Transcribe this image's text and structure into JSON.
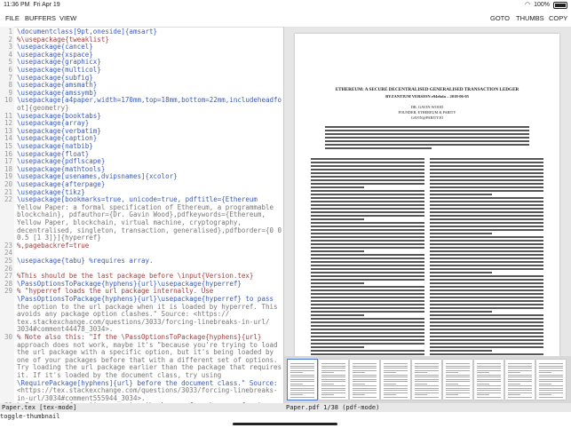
{
  "status": {
    "time": "11:36 PM",
    "date": "Fri Apr 19",
    "battery": "100%"
  },
  "menu": {
    "file": "FILE",
    "buffers": "BUFFERS",
    "view": "VIEW",
    "goto": "GOTO",
    "thumbs": "THUMBS",
    "copy": "COPY"
  },
  "editor": {
    "lines": [
      {
        "n": "1",
        "t": "\\documentclass[9pt,oneside]{amsart}"
      },
      {
        "n": "2",
        "t": "%\\usepackage{tweaklist}"
      },
      {
        "n": "3",
        "t": "\\usepackage{cancel}"
      },
      {
        "n": "4",
        "t": "\\usepackage{xspace}"
      },
      {
        "n": "5",
        "t": "\\usepackage{graphicx}"
      },
      {
        "n": "6",
        "t": "\\usepackage{multicol}"
      },
      {
        "n": "7",
        "t": "\\usepackage{subfig}"
      },
      {
        "n": "8",
        "t": "\\usepackage{amsmath}"
      },
      {
        "n": "9",
        "t": "\\usepackage{amssymb}"
      },
      {
        "n": "10",
        "t": "\\usepackage[a4paper,width=170mm,top=18mm,bottom=22mm,includeheadfo"
      },
      {
        "n": "",
        "t": "ot]{geometry}"
      },
      {
        "n": "11",
        "t": "\\usepackage{booktabs}"
      },
      {
        "n": "12",
        "t": "\\usepackage{array}"
      },
      {
        "n": "13",
        "t": "\\usepackage{verbatim}"
      },
      {
        "n": "14",
        "t": "\\usepackage{caption}"
      },
      {
        "n": "15",
        "t": "\\usepackage{natbib}"
      },
      {
        "n": "16",
        "t": "\\usepackage{float}"
      },
      {
        "n": "17",
        "t": "\\usepackage{pdflscape}"
      },
      {
        "n": "18",
        "t": "\\usepackage{mathtools}"
      },
      {
        "n": "19",
        "t": "\\usepackage[usenames,dvipsnames]{xcolor}"
      },
      {
        "n": "20",
        "t": "\\usepackage{afterpage}"
      },
      {
        "n": "21",
        "t": "\\usepackage{tikz}"
      },
      {
        "n": "22",
        "t": "\\usepackage[bookmarks=true, unicode=true, pdftitle={Ethereum"
      },
      {
        "n": "",
        "t": "Yellow Paper: a formal specification of Ethereum, a programmable"
      },
      {
        "n": "",
        "t": "blockchain}, pdfauthor={Dr. Gavin Wood},pdfkeywords={Ethereum,"
      },
      {
        "n": "",
        "t": "Yellow Paper, blockchain, virtual machine, cryptography,"
      },
      {
        "n": "",
        "t": "decentralised, singleton, transaction, generalised},pdfborder={0 0"
      },
      {
        "n": "",
        "t": "0.5 [1 3]}]{hyperref}"
      },
      {
        "n": "23",
        "t": "%,pagebackref=true"
      },
      {
        "n": "24",
        "t": ""
      },
      {
        "n": "25",
        "t": "\\usepackage{tabu} %requires array."
      },
      {
        "n": "26",
        "t": ""
      },
      {
        "n": "27",
        "t": "%This should be the last package before \\input{Version.tex}"
      },
      {
        "n": "28",
        "t": "\\PassOptionsToPackage{hyphens}{url}\\usepackage{hyperref}"
      },
      {
        "n": "29",
        "t": "% \"hyperref loads the url package internally. Use"
      },
      {
        "n": "",
        "t": "\\PassOptionsToPackage{hyphens}{url}\\usepackage{hyperref} to pass"
      },
      {
        "n": "",
        "t": "the option to the url package when it is loaded by hyperref. This"
      },
      {
        "n": "",
        "t": "avoids any package option clashes.\" Source: <https://"
      },
      {
        "n": "",
        "t": "tex.stackexchange.com/questions/3033/forcing-linebreaks-in-url/"
      },
      {
        "n": "",
        "t": "3034#comment44478_3034>."
      },
      {
        "n": "30",
        "t": "% Note also this: \"If the \\PassOptionsToPackage{hyphens}{url}"
      },
      {
        "n": "",
        "t": "approach does not work, maybe it's \"because you're trying to load"
      },
      {
        "n": "",
        "t": "the url package with a specific option, but it's being loaded by"
      },
      {
        "n": "",
        "t": "one of your packages before that with a different set of options."
      },
      {
        "n": "",
        "t": "Try loading the url package earlier than the package that requires"
      },
      {
        "n": "",
        "t": "it. If it's loaded by the document class, try using"
      },
      {
        "n": "",
        "t": "\\RequirePackage[hyphens]{url} before the document class.\" Source:"
      },
      {
        "n": "",
        "t": "<https://tex.stackexchange.com/questions/3033/forcing-linebreaks-"
      },
      {
        "n": "",
        "t": "in-url/3034#comment555944_3034>."
      },
      {
        "n": "31",
        "t": "% For more information on using the hyperref package, refer to"
      }
    ]
  },
  "pdf": {
    "title": "ETHEREUM: A SECURE DECENTRALISED GENERALISED TRANSACTION LEDGER",
    "subtitle": "BYZANTIUM VERSION e94ebda – 2018-06-05",
    "author": "DR. GAVIN WOOD",
    "affil": "FOUNDER, ETHEREUM & PARITY",
    "email": "GAVIN@PARITY.IO",
    "thumb_count": 9
  },
  "modeline": {
    "left": "Paper.tex [tex-mode]",
    "right": "Paper.pdf 1/38 (pdf-mode)"
  },
  "minibuffer": "toggle-thumbnail"
}
